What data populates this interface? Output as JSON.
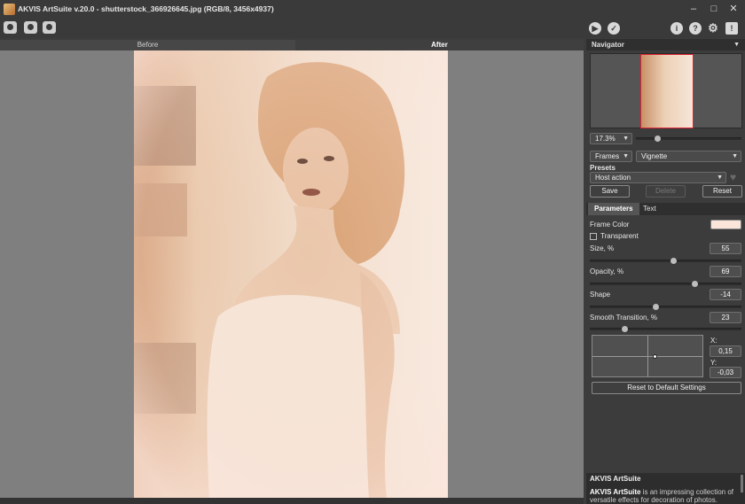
{
  "window": {
    "title": "AKVIS ArtSuite v.20.0 - shutterstock_366926645.jpg (RGB/8, 3456x4937)",
    "minimize_icon": "minimize-icon",
    "maximize_icon": "maximize-icon",
    "close_icon": "close-icon"
  },
  "toolbar": {
    "left_icons": [
      "open-image-icon",
      "save-image-icon",
      "print-image-icon"
    ],
    "right_icons": [
      "run-icon",
      "apply-icon",
      "info-icon",
      "help-icon",
      "settings-icon",
      "feedback-icon"
    ]
  },
  "view_tabs": {
    "before": "Before",
    "after": "After"
  },
  "navigator": {
    "title": "Navigator",
    "zoom": "17.3%",
    "zoom_slider_fraction": 0.2
  },
  "effect": {
    "category": "Frames",
    "type": "Vignette",
    "presets_label": "Presets",
    "preset": "Host action",
    "save_label": "Save",
    "delete_label": "Delete",
    "reset_label": "Reset"
  },
  "tabs": {
    "parameters": "Parameters",
    "text": "Text"
  },
  "params": {
    "frame_color_label": "Frame Color",
    "frame_color": "#fbe4da",
    "transparent_label": "Transparent",
    "size_label": "Size, %",
    "size_value": "55",
    "size_fraction": 0.55,
    "opacity_label": "Opacity, %",
    "opacity_value": "69",
    "opacity_fraction": 0.69,
    "shape_label": "Shape",
    "shape_value": "-14",
    "shape_fraction": 0.43,
    "smooth_label": "Smooth Transition, %",
    "smooth_value": "23",
    "smooth_fraction": 0.23,
    "x_label": "X:",
    "x_value": "0,15",
    "y_label": "Y:",
    "y_value": "-0,03",
    "reset_default_label": "Reset to Default Settings"
  },
  "info": {
    "title": "AKVIS ArtSuite",
    "text_bold": "AKVIS ArtSuite",
    "text_rest": " is an impressing collection of versatile effects for decoration of photos."
  },
  "colors": {
    "accent_frame": "#fbe4da",
    "photo_tint": "#f1ddcb"
  }
}
